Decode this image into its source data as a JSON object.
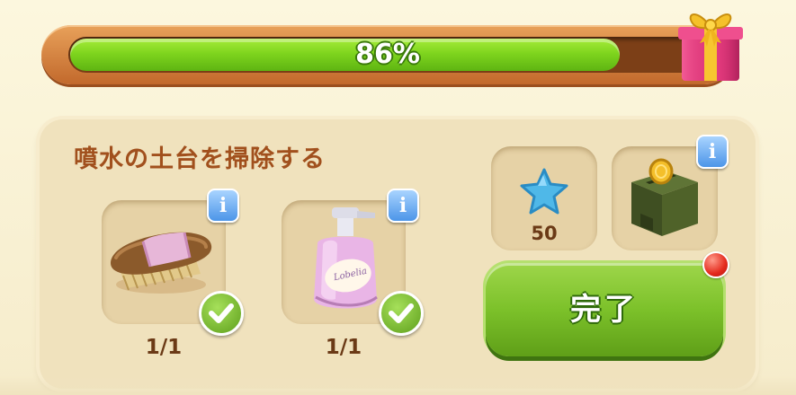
{
  "progress": {
    "fraction": 0.86,
    "label": "86%"
  },
  "task": {
    "title": "噴水の土台を掃除する",
    "items": [
      {
        "icon": "scrub-brush-icon",
        "count": "1/1",
        "completed": true
      },
      {
        "icon": "soap-bottle-icon",
        "count": "1/1",
        "completed": true
      }
    ]
  },
  "rewards": [
    {
      "icon": "blue-star-icon",
      "value": "50"
    },
    {
      "icon": "gold-coin-chest-icon",
      "value": ""
    }
  ],
  "actions": {
    "complete_label": "完了"
  },
  "colors": {
    "progress_fill": "#7fd51e",
    "progress_frame": "#c2692c",
    "title_text": "#a1501d",
    "button_green": "#7cc12a",
    "info_blue": "#4c95e8",
    "notify_red": "#e42a1d"
  }
}
